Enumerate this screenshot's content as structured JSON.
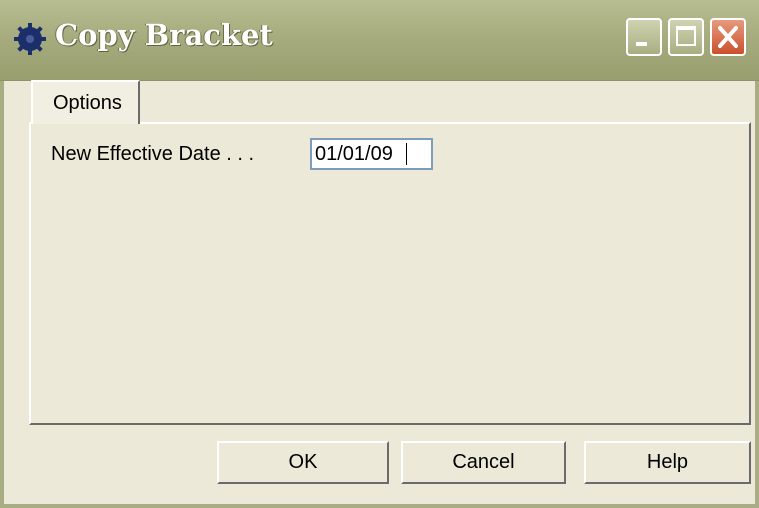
{
  "window": {
    "title": "Copy Bracket",
    "icon": "gear-icon",
    "controls": [
      "minimize-icon",
      "maximize-icon",
      "close-icon"
    ],
    "colors": {
      "titlebar": "#a5ab7c",
      "close": "#c9502c",
      "face": "#ece9d8"
    }
  },
  "tabs": [
    {
      "label": "Options",
      "active": true
    }
  ],
  "form": {
    "effective_date_label": "New Effective Date . . .",
    "effective_date_value": "01/01/09"
  },
  "buttons": {
    "ok": "OK",
    "cancel": "Cancel",
    "help": "Help"
  }
}
